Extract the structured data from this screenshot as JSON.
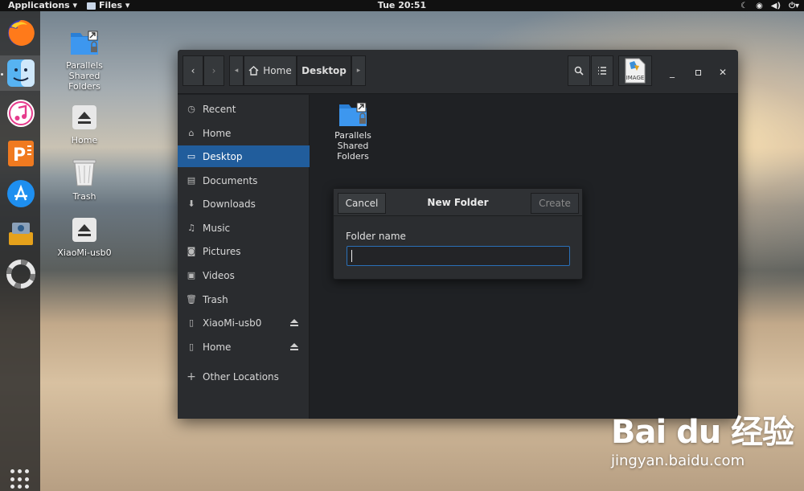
{
  "topbar": {
    "applications_label": "Applications ▾",
    "files_label": "Files ▾",
    "clock": "Tue 20:51",
    "tray_icons": [
      "night-mode-icon",
      "network-icon",
      "volume-icon",
      "power-icon"
    ]
  },
  "dock": {
    "apps": [
      "firefox-icon",
      "finder-icon",
      "itunes-icon",
      "wps-presentation-icon",
      "app-store-icon",
      "parallels-icon",
      "help-icon"
    ],
    "show_apps_icon": "grid-icon"
  },
  "desktop_icons": [
    {
      "label": "Parallels Shared Folders",
      "icon": "shared-folder-icon"
    },
    {
      "label": "Home",
      "icon": "eject-drive-icon"
    },
    {
      "label": "Trash",
      "icon": "trash-icon"
    },
    {
      "label": "XiaoMi-usb0",
      "icon": "eject-drive-icon"
    }
  ],
  "files_window": {
    "path": {
      "home": "Home",
      "current": "Desktop"
    },
    "image_badge": "IMAGE",
    "sidebar": [
      {
        "label": "Recent",
        "icon": "clock-icon"
      },
      {
        "label": "Home",
        "icon": "home-icon"
      },
      {
        "label": "Desktop",
        "icon": "desktop-icon",
        "active": true
      },
      {
        "label": "Documents",
        "icon": "documents-icon"
      },
      {
        "label": "Downloads",
        "icon": "downloads-icon"
      },
      {
        "label": "Music",
        "icon": "music-icon"
      },
      {
        "label": "Pictures",
        "icon": "camera-icon"
      },
      {
        "label": "Videos",
        "icon": "video-icon"
      },
      {
        "label": "Trash",
        "icon": "trash-icon"
      },
      {
        "label": "XiaoMi-usb0",
        "icon": "drive-icon",
        "eject": true
      },
      {
        "label": "Home",
        "icon": "drive-icon",
        "eject": true
      },
      {
        "label": "Other Locations",
        "icon": "plus-icon"
      }
    ],
    "content_items": [
      {
        "label": "Parallels Shared Folders"
      }
    ]
  },
  "new_folder_dialog": {
    "cancel_label": "Cancel",
    "title": "New Folder",
    "create_label": "Create",
    "field_label": "Folder name",
    "field_value": ""
  },
  "watermark": {
    "main": "Bai du 经验",
    "sub": "jingyan.baidu.com"
  },
  "colors": {
    "accent": "#215d9c",
    "window_bg": "#1f2124",
    "header_bg": "#2b2d30"
  }
}
